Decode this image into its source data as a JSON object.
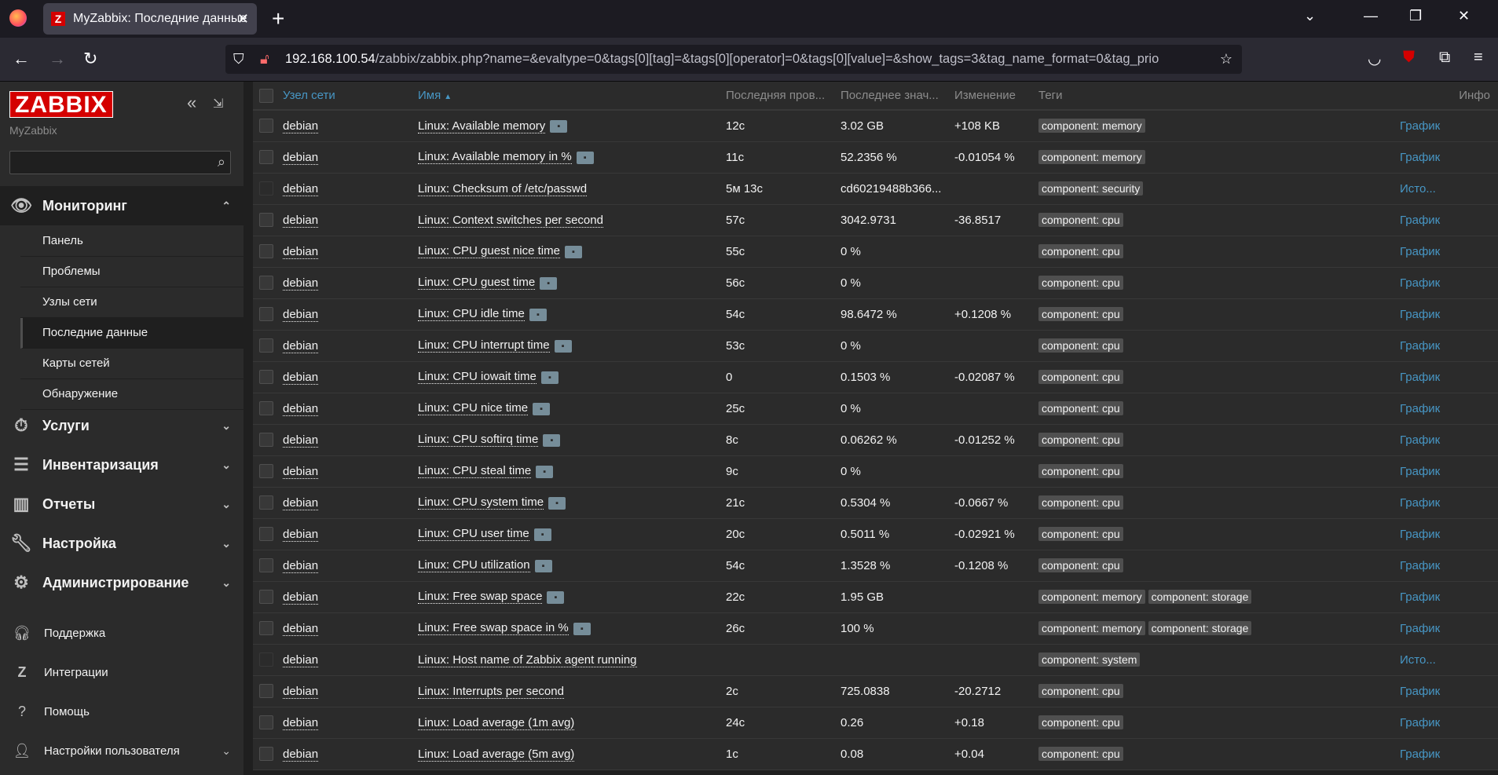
{
  "browser": {
    "tab_title": "MyZabbix: Последние данные",
    "tab_favicon_letter": "Z",
    "url_host": "192.168.100.54",
    "url_path": "/zabbix/zabbix.php?name=&evaltype=0&tags[0][tag]=&tags[0][operator]=0&tags[0][value]=&show_tags=3&tag_name_format=0&tag_prio"
  },
  "sidebar": {
    "logo": "ZABBIX",
    "instance": "MyZabbix",
    "search_value": "",
    "monitoring": {
      "label": "Мониторинг",
      "items": [
        "Панель",
        "Проблемы",
        "Узлы сети",
        "Последние данные",
        "Карты сетей",
        "Обнаружение"
      ],
      "selected": "Последние данные"
    },
    "sections": [
      "Услуги",
      "Инвентаризация",
      "Отчеты",
      "Настройка",
      "Администрирование"
    ],
    "bottom": [
      "Поддержка",
      "Интеграции",
      "Помощь",
      "Настройки пользователя"
    ]
  },
  "table": {
    "headers": {
      "host": "Узел сети",
      "name": "Имя",
      "lastcheck": "Последняя пров...",
      "lastvalue": "Последнее знач...",
      "change": "Изменение",
      "tags": "Теги",
      "info": "Инфо"
    },
    "rows": [
      {
        "host": "debian",
        "name": "Linux: Available memory",
        "hint": true,
        "lastcheck": "12с",
        "lastvalue": "3.02 GB",
        "change": "+108 KB",
        "tags": [
          "component: memory"
        ],
        "action": "График",
        "cb": true
      },
      {
        "host": "debian",
        "name": "Linux: Available memory in %",
        "hint": true,
        "lastcheck": "11с",
        "lastvalue": "52.2356 %",
        "change": "-0.01054 %",
        "tags": [
          "component: memory"
        ],
        "action": "График",
        "cb": true
      },
      {
        "host": "debian",
        "name": "Linux: Checksum of /etc/passwd",
        "hint": false,
        "lastcheck": "5м 13с",
        "lastvalue": "cd60219488b366...",
        "change": "",
        "tags": [
          "component: security"
        ],
        "action": "Исто...",
        "cb": false
      },
      {
        "host": "debian",
        "name": "Linux: Context switches per second",
        "hint": false,
        "lastcheck": "57с",
        "lastvalue": "3042.9731",
        "change": "-36.8517",
        "tags": [
          "component: cpu"
        ],
        "action": "График",
        "cb": true
      },
      {
        "host": "debian",
        "name": "Linux: CPU guest nice time",
        "hint": true,
        "lastcheck": "55с",
        "lastvalue": "0 %",
        "change": "",
        "tags": [
          "component: cpu"
        ],
        "action": "График",
        "cb": true
      },
      {
        "host": "debian",
        "name": "Linux: CPU guest time",
        "hint": true,
        "lastcheck": "56с",
        "lastvalue": "0 %",
        "change": "",
        "tags": [
          "component: cpu"
        ],
        "action": "График",
        "cb": true
      },
      {
        "host": "debian",
        "name": "Linux: CPU idle time",
        "hint": true,
        "lastcheck": "54с",
        "lastvalue": "98.6472 %",
        "change": "+0.1208 %",
        "tags": [
          "component: cpu"
        ],
        "action": "График",
        "cb": true
      },
      {
        "host": "debian",
        "name": "Linux: CPU interrupt time",
        "hint": true,
        "lastcheck": "53с",
        "lastvalue": "0 %",
        "change": "",
        "tags": [
          "component: cpu"
        ],
        "action": "График",
        "cb": true
      },
      {
        "host": "debian",
        "name": "Linux: CPU iowait time",
        "hint": true,
        "lastcheck": "0",
        "lastvalue": "0.1503 %",
        "change": "-0.02087 %",
        "tags": [
          "component: cpu"
        ],
        "action": "График",
        "cb": true
      },
      {
        "host": "debian",
        "name": "Linux: CPU nice time",
        "hint": true,
        "lastcheck": "25с",
        "lastvalue": "0 %",
        "change": "",
        "tags": [
          "component: cpu"
        ],
        "action": "График",
        "cb": true
      },
      {
        "host": "debian",
        "name": "Linux: CPU softirq time",
        "hint": true,
        "lastcheck": "8с",
        "lastvalue": "0.06262 %",
        "change": "-0.01252 %",
        "tags": [
          "component: cpu"
        ],
        "action": "График",
        "cb": true
      },
      {
        "host": "debian",
        "name": "Linux: CPU steal time",
        "hint": true,
        "lastcheck": "9с",
        "lastvalue": "0 %",
        "change": "",
        "tags": [
          "component: cpu"
        ],
        "action": "График",
        "cb": true
      },
      {
        "host": "debian",
        "name": "Linux: CPU system time",
        "hint": true,
        "lastcheck": "21с",
        "lastvalue": "0.5304 %",
        "change": "-0.0667 %",
        "tags": [
          "component: cpu"
        ],
        "action": "График",
        "cb": true
      },
      {
        "host": "debian",
        "name": "Linux: CPU user time",
        "hint": true,
        "lastcheck": "20с",
        "lastvalue": "0.5011 %",
        "change": "-0.02921 %",
        "tags": [
          "component: cpu"
        ],
        "action": "График",
        "cb": true
      },
      {
        "host": "debian",
        "name": "Linux: CPU utilization",
        "hint": true,
        "lastcheck": "54с",
        "lastvalue": "1.3528 %",
        "change": "-0.1208 %",
        "tags": [
          "component: cpu"
        ],
        "action": "График",
        "cb": true
      },
      {
        "host": "debian",
        "name": "Linux: Free swap space",
        "hint": true,
        "lastcheck": "22с",
        "lastvalue": "1.95 GB",
        "change": "",
        "tags": [
          "component: memory",
          "component: storage"
        ],
        "action": "График",
        "cb": true
      },
      {
        "host": "debian",
        "name": "Linux: Free swap space in %",
        "hint": true,
        "lastcheck": "26с",
        "lastvalue": "100 %",
        "change": "",
        "tags": [
          "component: memory",
          "component: storage"
        ],
        "action": "График",
        "cb": true
      },
      {
        "host": "debian",
        "name": "Linux: Host name of Zabbix agent running",
        "hint": false,
        "lastcheck": "",
        "lastvalue": "",
        "change": "",
        "tags": [
          "component: system"
        ],
        "action": "Исто...",
        "cb": false
      },
      {
        "host": "debian",
        "name": "Linux: Interrupts per second",
        "hint": false,
        "lastcheck": "2с",
        "lastvalue": "725.0838",
        "change": "-20.2712",
        "tags": [
          "component: cpu"
        ],
        "action": "График",
        "cb": true
      },
      {
        "host": "debian",
        "name": "Linux: Load average (1m avg)",
        "hint": false,
        "lastcheck": "24с",
        "lastvalue": "0.26",
        "change": "+0.18",
        "tags": [
          "component: cpu"
        ],
        "action": "График",
        "cb": true
      },
      {
        "host": "debian",
        "name": "Linux: Load average (5m avg)",
        "hint": false,
        "lastcheck": "1с",
        "lastvalue": "0.08",
        "change": "+0.04",
        "tags": [
          "component: cpu"
        ],
        "action": "График",
        "cb": true
      }
    ]
  }
}
